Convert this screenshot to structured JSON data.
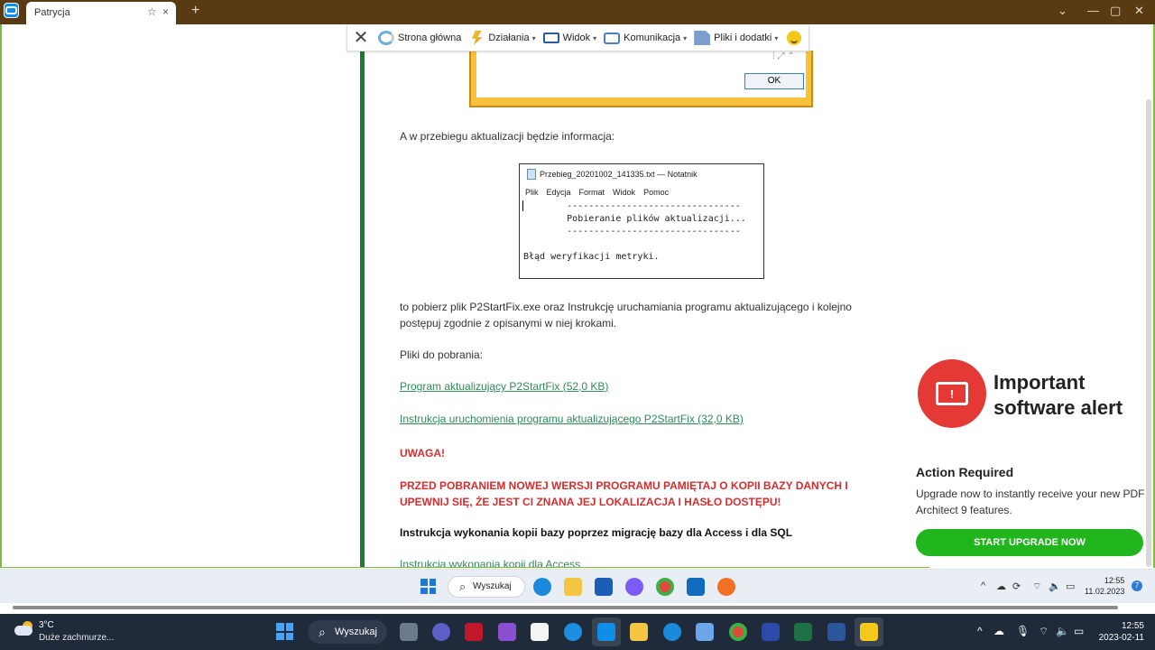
{
  "browser": {
    "tab_title": "Patrycja",
    "tab_star": "☆",
    "tab_close": "×",
    "new_tab": "+",
    "minimize": "⌄",
    "restore": "—",
    "maximize": "▢",
    "close": "✕",
    "accent": "#5a3a12"
  },
  "remote_toolbar": {
    "close": "✕",
    "items": [
      {
        "label": "Strona główna",
        "icon": "home-icon",
        "has_caret": false
      },
      {
        "label": "Działania",
        "icon": "lightning-icon",
        "has_caret": true
      },
      {
        "label": "Widok",
        "icon": "monitor-icon",
        "has_caret": true
      },
      {
        "label": "Komunikacja",
        "icon": "chat-icon",
        "has_caret": true
      },
      {
        "label": "Pliki i dodatki",
        "icon": "file-icon",
        "has_caret": true
      }
    ],
    "caret": "▾"
  },
  "dialog": {
    "ok": "OK"
  },
  "article": {
    "p1": "A w przebiegu aktualizacji będzie informacja:",
    "p2": "to pobierz plik P2StartFix.exe oraz Instrukcję uruchamiania programu aktualizującego i kolejno postępuj zgodnie z opisanymi w niej krokami.",
    "p3": "Pliki do pobrania:",
    "link1": "Program aktualizujący P2StartFix (52,0 KB)",
    "link2": "Instrukcja uruchomienia programu aktualizującego P2StartFix (32,0 KB)",
    "warning_title": "UWAGA!",
    "warning_text": "PRZED POBRANIEM NOWEJ WERSJI PROGRAMU PAMIĘTAJ O KOPII BAZY DANYCH I UPEWNIJ SIĘ, ŻE JEST CI ZNANA JEJ LOKALIZACJA I HASŁO DOSTĘPU!",
    "heading": "Instrukcja wykonania kopii bazy poprzez migrację bazy dla Access i dla SQL",
    "link3": "Instrukcja wykonania kopii dla Access"
  },
  "notepad": {
    "title": "Przebieg_20201002_141335.txt — Notatnik",
    "menu": [
      "Plik",
      "Edycja",
      "Format",
      "Widok",
      "Pomoc"
    ],
    "body": "        --------------------------------\n        Pobieranie plików aktualizacji...\n        --------------------------------\n\nBłąd weryfikacji metryki."
  },
  "ad": {
    "headline": "Important\nsoftware alert",
    "title": "Action Required",
    "text": "Upgrade now to instantly receive your new PDF Architect 9 features.",
    "button": "START UPGRADE NOW",
    "button_color": "#22b61e",
    "badge_color": "#e53935"
  },
  "remote_taskbar": {
    "search": "Wyszukaj",
    "time": "12:55",
    "date": "11.02.2023",
    "notifications": "7",
    "tray_caret": "^"
  },
  "local_taskbar": {
    "temperature": "3°C",
    "weather": "Duże zachmurze...",
    "search": "Wyszukaj",
    "time": "12:55",
    "date": "2023-02-11",
    "tray_caret": "^"
  }
}
